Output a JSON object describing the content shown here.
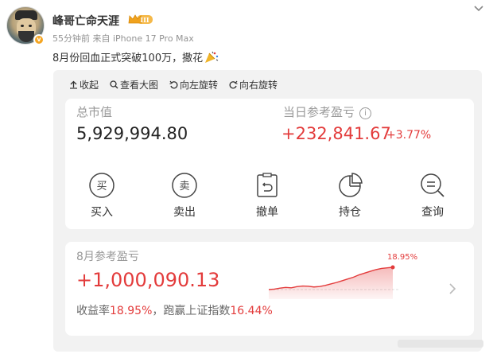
{
  "post": {
    "username": "峰哥亡命天涯",
    "level_badge": "III",
    "verified_mark": "v",
    "meta": "55分钟前  来自 iPhone 17 Pro Max",
    "text": "8月份回血正式突破100万，撒花"
  },
  "toolbar": {
    "collapse": "收起",
    "view_large": "查看大图",
    "rotate_left": "向左旋转",
    "rotate_right": "向右旋转"
  },
  "assets": {
    "total_label": "总市值",
    "total_value": "5,929,994.80",
    "day_label": "当日参考盈亏",
    "info_icon": "i",
    "day_value": "+232,841.67",
    "day_pct": "+3.77%"
  },
  "actions": [
    {
      "icon_char": "买",
      "label": "买入"
    },
    {
      "icon_char": "卖",
      "label": "卖出"
    },
    {
      "icon_char": "",
      "label": "撤单"
    },
    {
      "icon_char": "",
      "label": "持仓"
    },
    {
      "icon_char": "",
      "label": "查询"
    }
  ],
  "monthly": {
    "label": "8月参考盈亏",
    "value": "+1,000,090.13",
    "rate_label": "收益率",
    "rate_value": "18.95%",
    "compare_label": "，跑赢上证指数",
    "compare_value": "16.44%",
    "spark_end_label": "18.95%"
  },
  "chart_data": {
    "type": "line",
    "values": [
      0.0,
      0.4,
      1.2,
      1.8,
      1.5,
      2.5,
      3.0,
      2.8,
      2.2,
      2.6,
      3.5,
      4.8,
      6.0,
      7.5,
      9.0,
      10.5,
      12.5,
      14.0,
      15.5,
      17.0,
      18.0,
      18.5,
      18.95
    ],
    "series": [
      {
        "name": "",
        "values": []
      }
    ]
  },
  "colors": {
    "accent_red": "#e33b3b",
    "muted": "#999999"
  }
}
